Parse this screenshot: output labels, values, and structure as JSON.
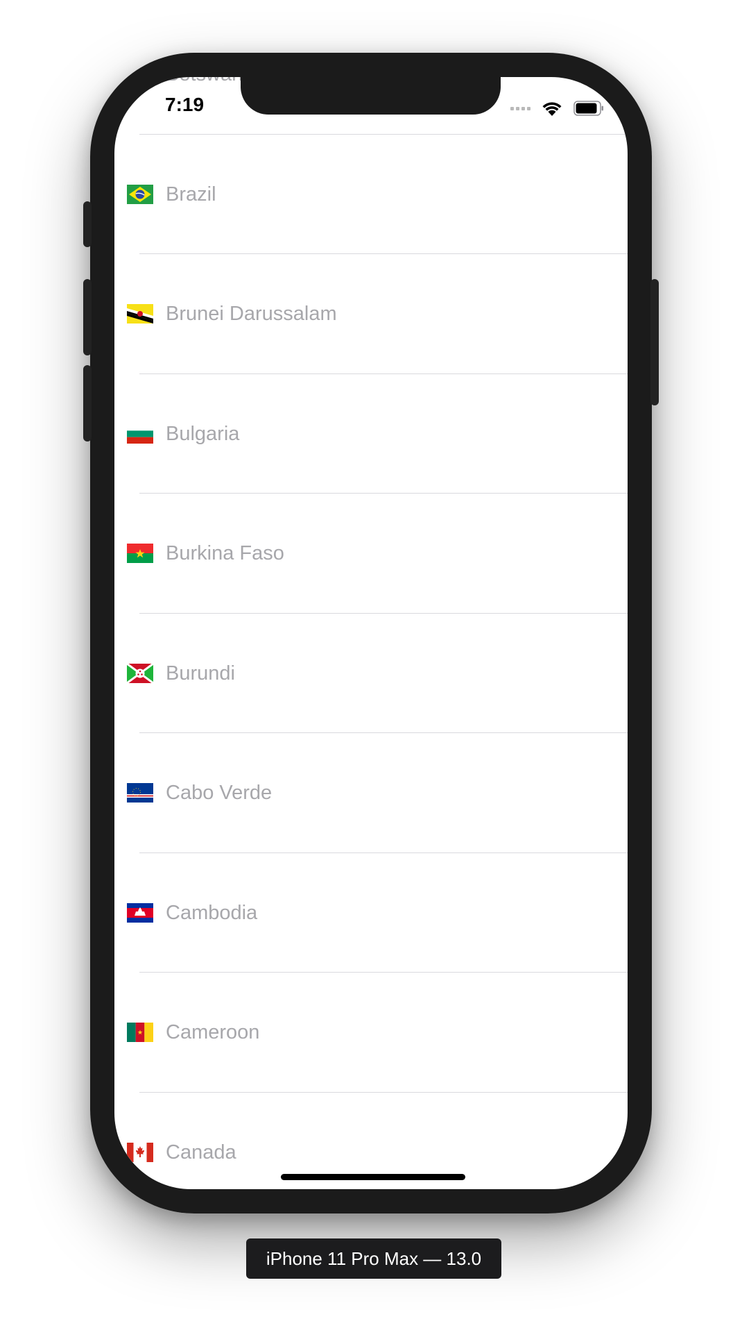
{
  "status_bar": {
    "time": "7:19"
  },
  "countries": [
    {
      "name": "Botswana",
      "flag": "botswana-flag-icon"
    },
    {
      "name": "Brazil",
      "flag": "brazil-flag-icon"
    },
    {
      "name": "Brunei Darussalam",
      "flag": "brunei-flag-icon"
    },
    {
      "name": "Bulgaria",
      "flag": "bulgaria-flag-icon"
    },
    {
      "name": "Burkina Faso",
      "flag": "burkina-faso-flag-icon"
    },
    {
      "name": "Burundi",
      "flag": "burundi-flag-icon"
    },
    {
      "name": "Cabo Verde",
      "flag": "cabo-verde-flag-icon"
    },
    {
      "name": "Cambodia",
      "flag": "cambodia-flag-icon"
    },
    {
      "name": "Cameroon",
      "flag": "cameroon-flag-icon"
    },
    {
      "name": "Canada",
      "flag": "canada-flag-icon"
    }
  ],
  "simulator": {
    "device_label": "iPhone 11 Pro Max — 13.0"
  },
  "colors": {
    "row_text": "#a7a7ab",
    "divider": "#d9d9de",
    "device_frame": "#1b1b1b"
  }
}
